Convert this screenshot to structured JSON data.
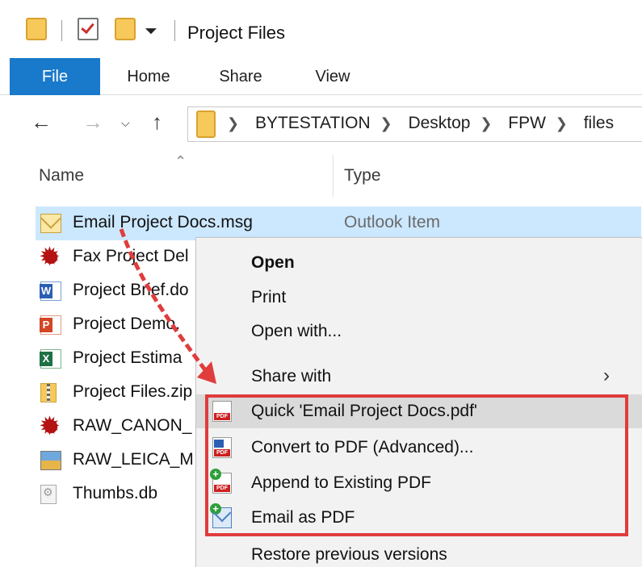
{
  "window": {
    "title": "Project Files"
  },
  "ribbon": {
    "tabs": [
      "File",
      "Home",
      "Share",
      "View"
    ]
  },
  "address_bar": {
    "crumbs": [
      "BYTESTATION",
      "Desktop",
      "FPW",
      "files"
    ]
  },
  "columns": {
    "name": "Name",
    "type": "Type"
  },
  "files": [
    {
      "name": "Email Project Docs.msg",
      "type": "Outlook Item",
      "icon": "outlook-msg-icon"
    },
    {
      "name": "Fax Project Del",
      "icon": "fax-file-icon"
    },
    {
      "name": "Project Brief.do",
      "icon": "word-doc-icon"
    },
    {
      "name": "Project Demo.",
      "icon": "powerpoint-icon"
    },
    {
      "name": "Project Estima",
      "icon": "excel-icon"
    },
    {
      "name": "Project Files.zip",
      "icon": "zip-folder-icon"
    },
    {
      "name": "RAW_CANON_",
      "icon": "raw-file-icon"
    },
    {
      "name": "RAW_LEICA_M",
      "icon": "image-file-icon"
    },
    {
      "name": "Thumbs.db",
      "icon": "db-file-icon"
    }
  ],
  "context_menu": {
    "open": "Open",
    "print": "Print",
    "open_with": "Open with...",
    "share_with": "Share with",
    "quick_pdf": "Quick 'Email Project Docs.pdf'",
    "convert_pdf": "Convert to PDF (Advanced)...",
    "append_pdf": "Append to Existing PDF",
    "email_pdf": "Email as PDF",
    "restore": "Restore previous versions"
  },
  "colors": {
    "file_tab": "#1979ca",
    "selection": "#cce8ff",
    "highlight_box": "#e03c3c",
    "annotation_arrow": "#e03c3c"
  }
}
